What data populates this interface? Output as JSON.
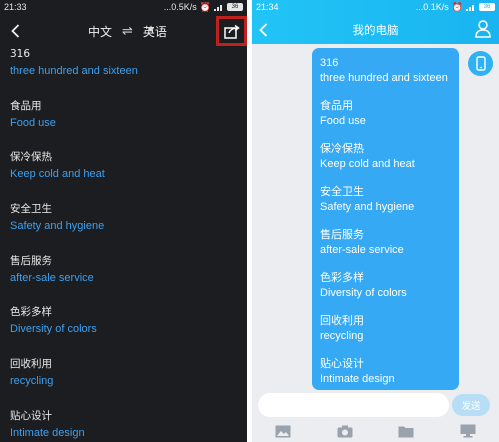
{
  "left_panel": {
    "status_bar": {
      "time": "21:33",
      "net_speed": "...0.5K/s",
      "battery": "36"
    },
    "source_lang": "中文",
    "swap_symbol": "⇌",
    "target_lang": "英语",
    "entries": [
      {
        "zh": "316",
        "en": "three hundred and sixteen"
      },
      {
        "zh": "食品用",
        "en": "Food use"
      },
      {
        "zh": "保冷保热",
        "en": "Keep cold and heat"
      },
      {
        "zh": "安全卫生",
        "en": "Safety and hygiene"
      },
      {
        "zh": "售后服务",
        "en": "after-sale service"
      },
      {
        "zh": "色彩多样",
        "en": "Diversity of colors"
      },
      {
        "zh": "回收利用",
        "en": "recycling"
      },
      {
        "zh": "贴心设计",
        "en": "Intimate design"
      }
    ],
    "colors": {
      "background": "#1c1d20",
      "translation": "#3ea0ef",
      "highlight_box": "#c0201e"
    }
  },
  "right_panel": {
    "status_bar": {
      "time": "21:34",
      "net_speed": "...0.1K/s",
      "battery": "36"
    },
    "title": "我的电脑",
    "message_lines": [
      {
        "zh": "316",
        "en": "three hundred and sixteen"
      },
      {
        "zh": "食品用",
        "en": "Food use"
      },
      {
        "zh": "保冷保热",
        "en": "Keep cold and heat"
      },
      {
        "zh": "安全卫生",
        "en": "Safety and hygiene"
      },
      {
        "zh": "售后服务",
        "en": "after-sale service"
      },
      {
        "zh": "色彩多样",
        "en": "Diversity of colors"
      },
      {
        "zh": "回收利用",
        "en": "recycling"
      },
      {
        "zh": "贴心设计",
        "en": "Intimate design"
      }
    ],
    "input_placeholder": "",
    "send_label": "发送",
    "toolbar_icons": [
      "image-icon",
      "camera-icon",
      "folder-icon",
      "computer-icon"
    ],
    "colors": {
      "header": "#19b4f1",
      "bubble": "#36a9f4",
      "chat_background": "#ebedf0"
    }
  }
}
